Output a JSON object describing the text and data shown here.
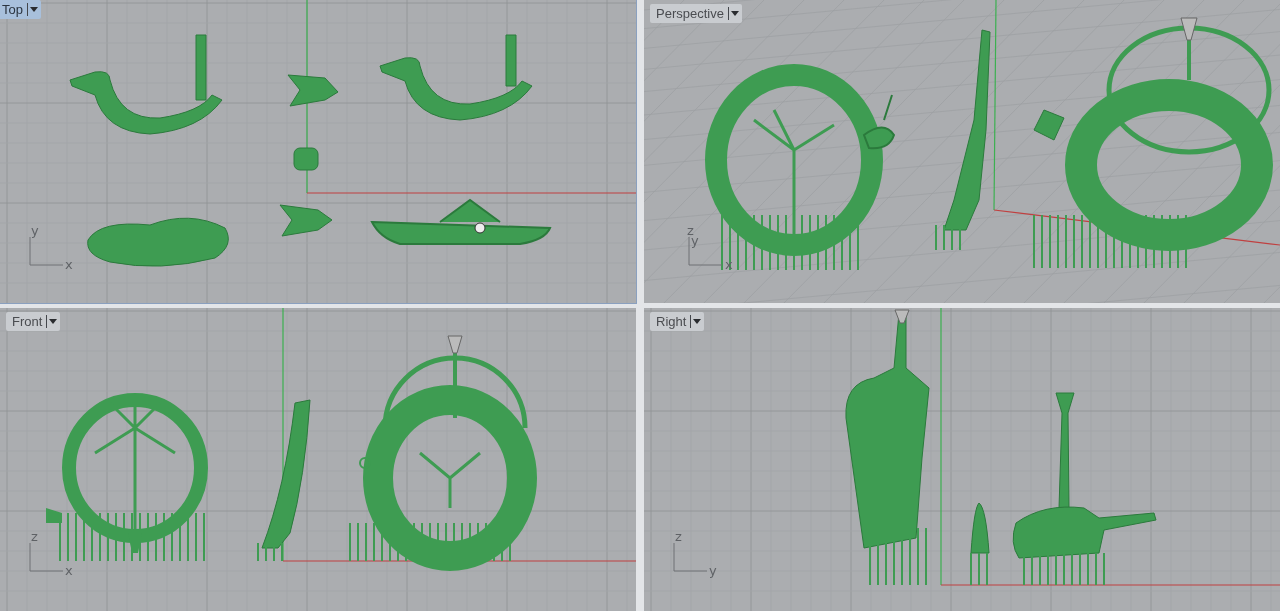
{
  "viewports": [
    {
      "title": "Top",
      "selected": true,
      "kind": "top",
      "axes": [
        "y",
        "x"
      ]
    },
    {
      "title": "Perspective",
      "selected": false,
      "kind": "perspective",
      "axes": [
        "z",
        "y",
        "x"
      ]
    },
    {
      "title": "Front",
      "selected": false,
      "kind": "front",
      "axes": [
        "z",
        "x"
      ]
    },
    {
      "title": "Right",
      "selected": false,
      "kind": "right",
      "axes": [
        "z",
        "y"
      ]
    }
  ]
}
